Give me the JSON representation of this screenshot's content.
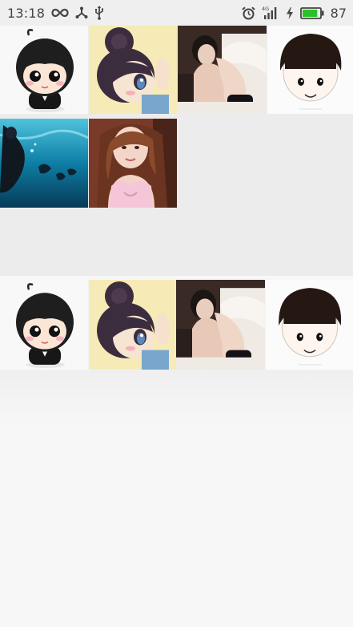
{
  "status_bar": {
    "time": "13:18",
    "network": "4G",
    "battery_percent": "87",
    "battery_level": 0.87,
    "battery_color": "#29c22a",
    "icons": [
      "infinity-icon",
      "share-icon",
      "usb-icon",
      "alarm-icon",
      "signal-icon",
      "charging-icon",
      "battery-icon"
    ]
  },
  "gallery_top": {
    "images": [
      {
        "name": "cartoon-boy"
      },
      {
        "name": "cartoon-girl-bun"
      },
      {
        "name": "woman-on-sofa"
      },
      {
        "name": "cartoon-bowl-cut"
      },
      {
        "name": "underwater-swimmers"
      },
      {
        "name": "woman-selfie"
      }
    ]
  },
  "gallery_bottom": {
    "images": [
      {
        "name": "cartoon-boy"
      },
      {
        "name": "cartoon-girl-bun"
      },
      {
        "name": "woman-on-sofa"
      },
      {
        "name": "cartoon-bowl-cut"
      }
    ]
  }
}
